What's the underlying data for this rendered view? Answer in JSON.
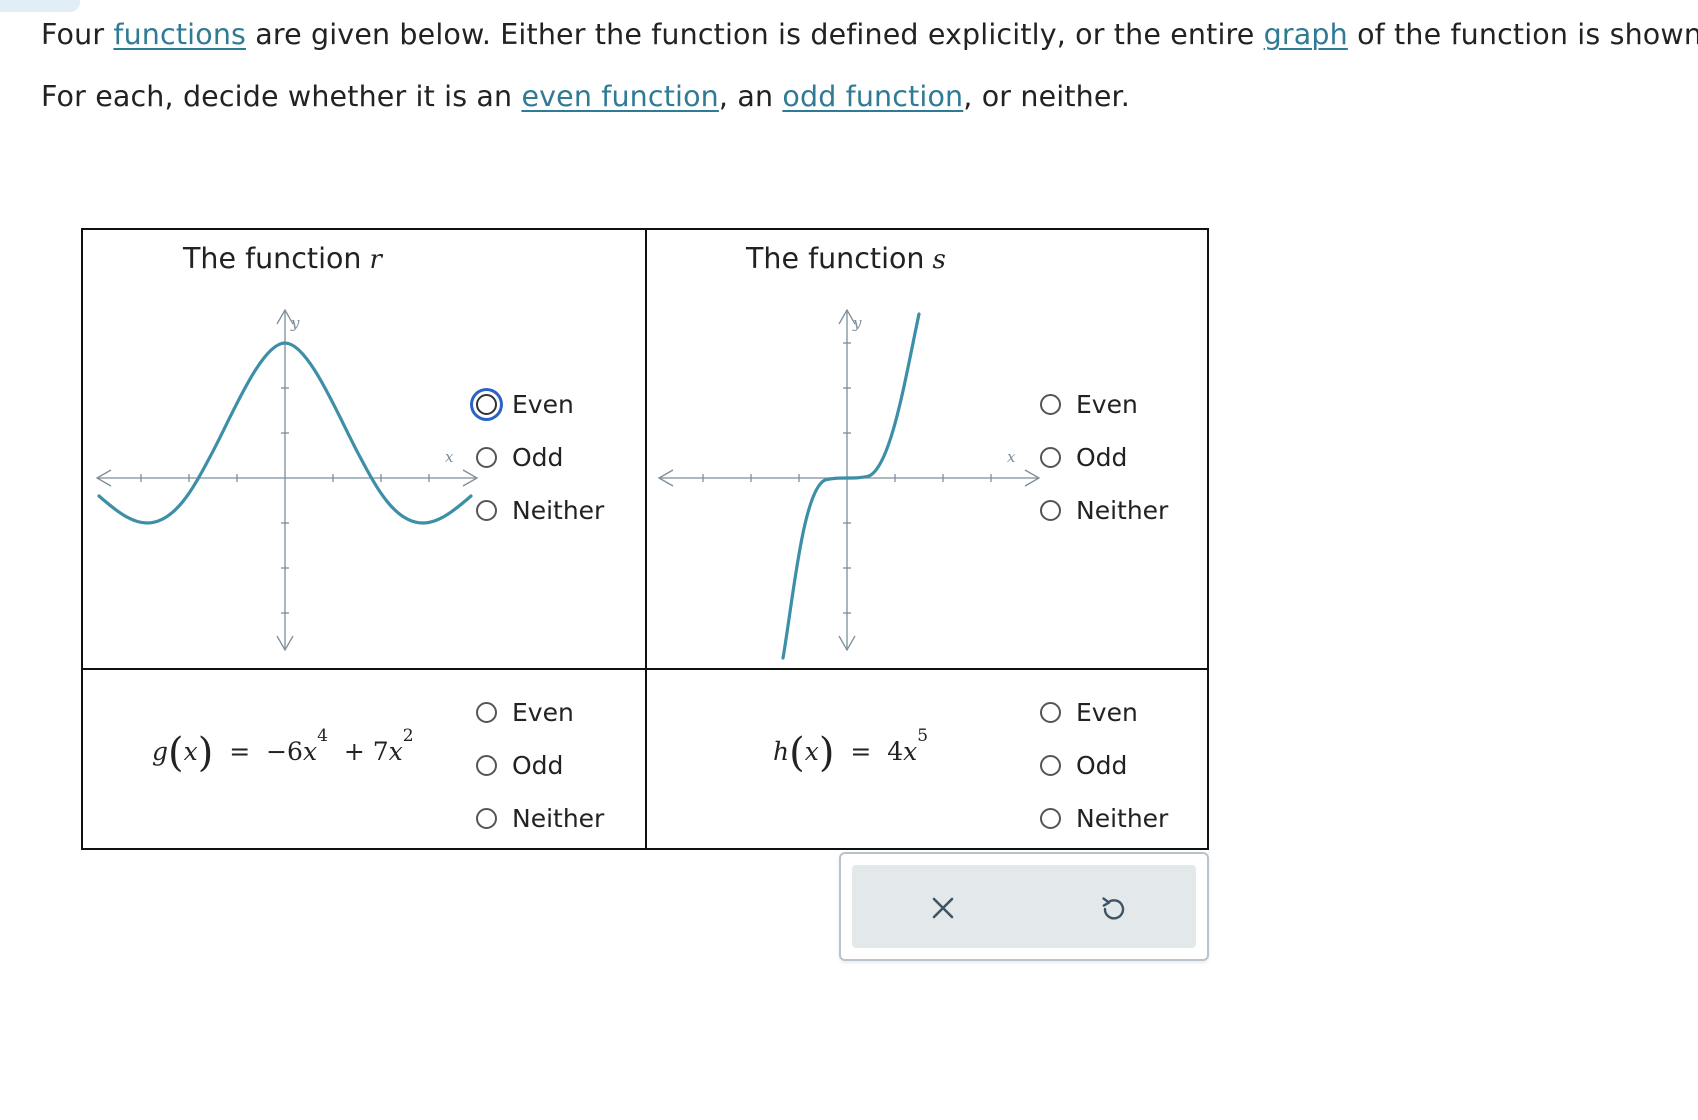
{
  "intro": {
    "line1": {
      "t1": "Four ",
      "link1": "functions",
      "t2": " are given below. Either the function is defined explicitly, or the entire ",
      "link2": "graph",
      "t3": " of the function is shown."
    },
    "line2": {
      "t1": "For each, decide whether it is an ",
      "link1": "even function",
      "t2": ", an ",
      "link2": "odd function",
      "t3": ", or neither."
    }
  },
  "cells": [
    {
      "title": "The function",
      "var": "r",
      "axis_x": "x",
      "axis_y": "y",
      "options": [
        "Even",
        "Odd",
        "Neither"
      ],
      "focused_option": "Even"
    },
    {
      "title": "The function",
      "var": "s",
      "axis_x": "x",
      "axis_y": "y",
      "options": [
        "Even",
        "Odd",
        "Neither"
      ]
    },
    {
      "formula": {
        "fn": "g",
        "arg": "x",
        "eq": "=",
        "t1": "−6",
        "x1": "x",
        "e1": "4",
        "op": "+ 7",
        "x2": "x",
        "e2": "2"
      },
      "options": [
        "Even",
        "Odd",
        "Neither"
      ]
    },
    {
      "formula": {
        "fn": "h",
        "arg": "x",
        "eq": "=",
        "t1": "4",
        "x1": "x",
        "e1": "5"
      },
      "options": [
        "Even",
        "Odd",
        "Neither"
      ]
    }
  ],
  "toolbar": {
    "clear_icon": "x-icon",
    "undo_icon": "undo-icon"
  },
  "colors": {
    "link": "#2f7b95",
    "curve": "#3d8fa8",
    "axis": "#7c8e9a",
    "focus": "#2b63c4"
  }
}
